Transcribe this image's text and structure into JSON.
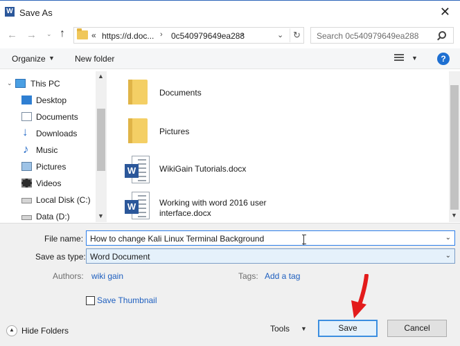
{
  "window": {
    "title": "Save As",
    "app_icon": "word-icon",
    "close_glyph": "✕"
  },
  "address": {
    "back_glyph": "←",
    "forward_glyph": "→",
    "recent_glyph": "⌄",
    "up_glyph": "↑",
    "chevrons": "«",
    "segments": [
      "https://d.doc...",
      "0c540979649ea288"
    ],
    "separator": "›",
    "dropdown_glyph": "⌄",
    "refresh_glyph": "↻"
  },
  "search": {
    "placeholder": "Search 0c540979649ea288"
  },
  "toolbar": {
    "organize_label": "Organize",
    "organize_arrow": "▼",
    "new_folder_label": "New folder",
    "view_arrow": "▼",
    "help_glyph": "?"
  },
  "nav": {
    "items": [
      {
        "label": "This PC",
        "icon": "this-pc-icon",
        "caret": "⌄"
      },
      {
        "label": "Desktop",
        "icon": "desktop-icon"
      },
      {
        "label": "Documents",
        "icon": "documents-icon"
      },
      {
        "label": "Downloads",
        "icon": "downloads-icon"
      },
      {
        "label": "Music",
        "icon": "music-icon"
      },
      {
        "label": "Pictures",
        "icon": "pictures-icon"
      },
      {
        "label": "Videos",
        "icon": "videos-icon"
      },
      {
        "label": "Local Disk (C:)",
        "icon": "disk-icon"
      },
      {
        "label": "Data (D:)",
        "icon": "disk-icon"
      }
    ],
    "scroll_up": "▲",
    "scroll_down": "▼"
  },
  "files": [
    {
      "name": "Documents",
      "type": "folder"
    },
    {
      "name": "Pictures",
      "type": "folder"
    },
    {
      "name": "WikiGain Tutorials.docx",
      "type": "word"
    },
    {
      "name": "Working with word 2016 user",
      "name_line2": "interface.docx",
      "type": "word"
    }
  ],
  "word_badge": "W",
  "form": {
    "file_name_label": "File name:",
    "file_name_value": "How to change Kali Linux Terminal Background",
    "save_type_label": "Save as type:",
    "save_type_value": "Word Document",
    "dropdown_glyph": "⌄",
    "authors_label": "Authors:",
    "authors_value": "wiki gain",
    "tags_label": "Tags:",
    "tags_value": "Add a tag",
    "save_thumbnail_label": "Save Thumbnail"
  },
  "footer": {
    "hide_folders_label": "Hide Folders",
    "tools_label": "Tools",
    "tools_arrow": "▼",
    "save_label": "Save",
    "cancel_label": "Cancel"
  },
  "colors": {
    "accent": "#1e5fbf",
    "word_blue": "#2b579a",
    "focus_border": "#3b8ee0",
    "annotation_red": "#e31b1b"
  }
}
